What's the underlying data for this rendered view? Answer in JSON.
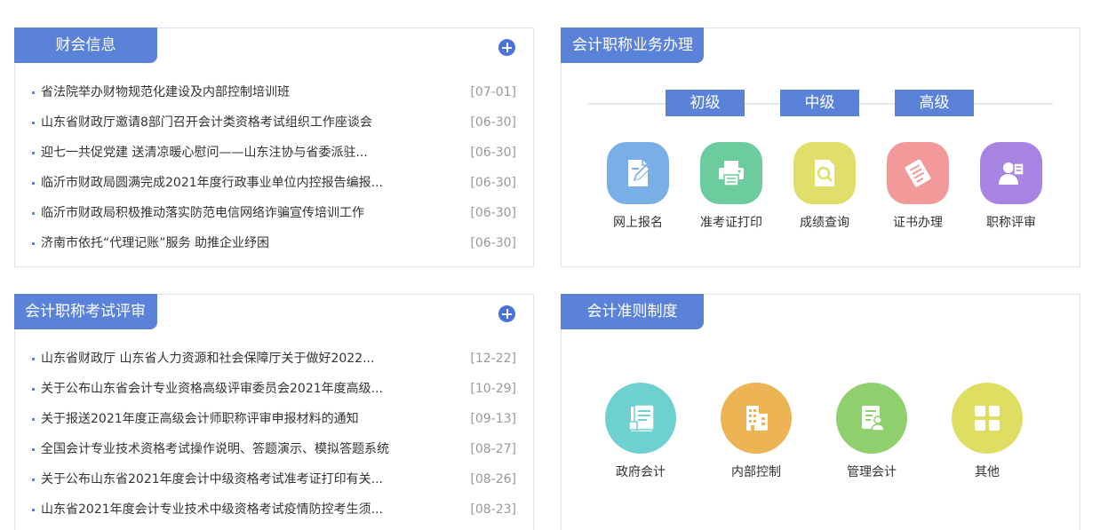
{
  "finance_news": {
    "title": "财会信息",
    "more_icon": "plus-circle-icon",
    "items": [
      {
        "text": "省法院举办财物规范化建设及内部控制培训班",
        "date": "[07-01]"
      },
      {
        "text": "山东省财政厅邀请8部门召开会计类资格考试组织工作座谈会",
        "date": "[06-30]"
      },
      {
        "text": "迎七一共促党建 送清凉暖心慰问——山东注协与省委派驻...",
        "date": "[06-30]"
      },
      {
        "text": "临沂市财政局圆满完成2021年度行政事业单位内控报告编报...",
        "date": "[06-30]"
      },
      {
        "text": "临沂市财政局积极推动落实防范电信网络诈骗宣传培训工作",
        "date": "[06-30]"
      },
      {
        "text": "济南市依托“代理记账”服务 助推企业纾困",
        "date": "[06-30]"
      }
    ]
  },
  "title_business": {
    "title": "会计职称业务办理",
    "levels": [
      "初级",
      "中级",
      "高级"
    ],
    "services": [
      {
        "label": "网上报名",
        "icon": "edit-form-icon",
        "color": "#7aaee6"
      },
      {
        "label": "准考证打印",
        "icon": "printer-icon",
        "color": "#6ccc9e"
      },
      {
        "label": "成绩查询",
        "icon": "search-document-icon",
        "color": "#dfdf6a"
      },
      {
        "label": "证书办理",
        "icon": "certificate-icon",
        "color": "#f29a9a"
      },
      {
        "label": "职称评审",
        "icon": "reviewer-icon",
        "color": "#a784e2"
      }
    ]
  },
  "exam_review": {
    "title": "会计职称考试评审",
    "more_icon": "plus-circle-icon",
    "items": [
      {
        "text": "山东省财政厅 山东省人力资源和社会保障厅关于做好2022...",
        "date": "[12-22]"
      },
      {
        "text": "关于公布山东省会计专业资格高级评审委员会2021年度高级...",
        "date": "[10-29]"
      },
      {
        "text": "关于报送2021年度正高级会计师职称评审申报材料的通知",
        "date": "[09-13]"
      },
      {
        "text": "全国会计专业技术资格考试操作说明、答题演示、模拟答题系统",
        "date": "[08-27]"
      },
      {
        "text": "关于公布山东省2021年度会计中级资格考试准考证打印有关...",
        "date": "[08-26]"
      },
      {
        "text": "山东省2021年度会计专业技术中级资格考试疫情防控考生须...",
        "date": "[08-23]"
      }
    ]
  },
  "standards": {
    "title": "会计准则制度",
    "categories": [
      {
        "label": "政府会计",
        "icon": "government-book-icon",
        "color": "#6fd1cf"
      },
      {
        "label": "内部控制",
        "icon": "building-icon",
        "color": "#ecb455"
      },
      {
        "label": "管理会计",
        "icon": "manager-document-icon",
        "color": "#8fcf6d"
      },
      {
        "label": "其他",
        "icon": "grid-icon",
        "color": "#dede62"
      }
    ]
  }
}
